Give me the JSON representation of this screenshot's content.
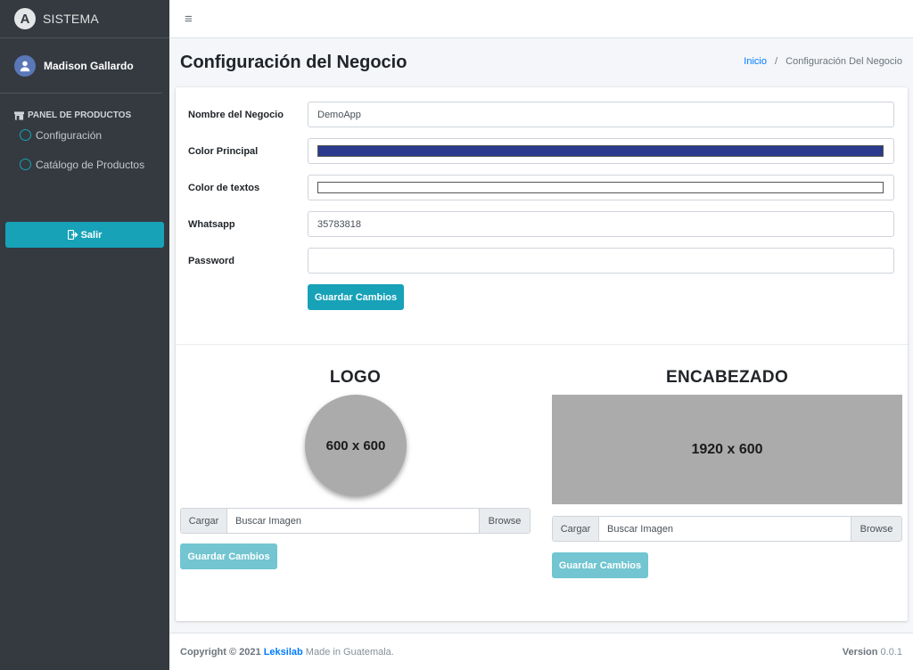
{
  "sidebar": {
    "brand_letter": "A",
    "brand_text": "SISTEMA",
    "user_name": "Madison Gallardo",
    "nav_header": "PANEL DE PRODUCTOS",
    "items": [
      {
        "label": "Configuración"
      },
      {
        "label": "Catálogo de Productos"
      }
    ],
    "logout_label": "Salir"
  },
  "topbar": {
    "menu_icon": "≡"
  },
  "header": {
    "title": "Configuración del Negocio",
    "breadcrumb": {
      "home": "Inicio",
      "separator": "/",
      "current": "Configuración Del Negocio"
    }
  },
  "form": {
    "fields": {
      "business_name": {
        "label": "Nombre del Negocio",
        "value": "DemoApp"
      },
      "main_color": {
        "label": "Color Principal",
        "value": "#2b3a8c"
      },
      "text_color": {
        "label": "Color de textos",
        "value": "#ffffff"
      },
      "whatsapp": {
        "label": "Whatsapp",
        "value": "35783818"
      },
      "password": {
        "label": "Password",
        "value": ""
      }
    },
    "save_label": "Guardar Cambios"
  },
  "logo_section": {
    "title": "LOGO",
    "placeholder": "600 x 600",
    "upload_prefix": "Cargar",
    "upload_placeholder": "Buscar Imagen",
    "browse_label": "Browse",
    "save_label": "Guardar Cambios"
  },
  "banner_section": {
    "title": "ENCABEZADO",
    "placeholder": "1920 x 600",
    "upload_prefix": "Cargar",
    "upload_placeholder": "Buscar Imagen",
    "browse_label": "Browse",
    "save_label": "Guardar Cambios"
  },
  "footer": {
    "copyright_prefix": "Copyright © 2021",
    "company": "Leksilab",
    "suffix": "Made in Guatemala.",
    "version_label": "Version",
    "version": "0.0.1"
  },
  "colors": {
    "sidebar_bg": "#343a40",
    "accent": "#17a2b8",
    "accent_light": "#72c5d1",
    "link": "#007bff",
    "placeholder_gray": "#ababab"
  }
}
